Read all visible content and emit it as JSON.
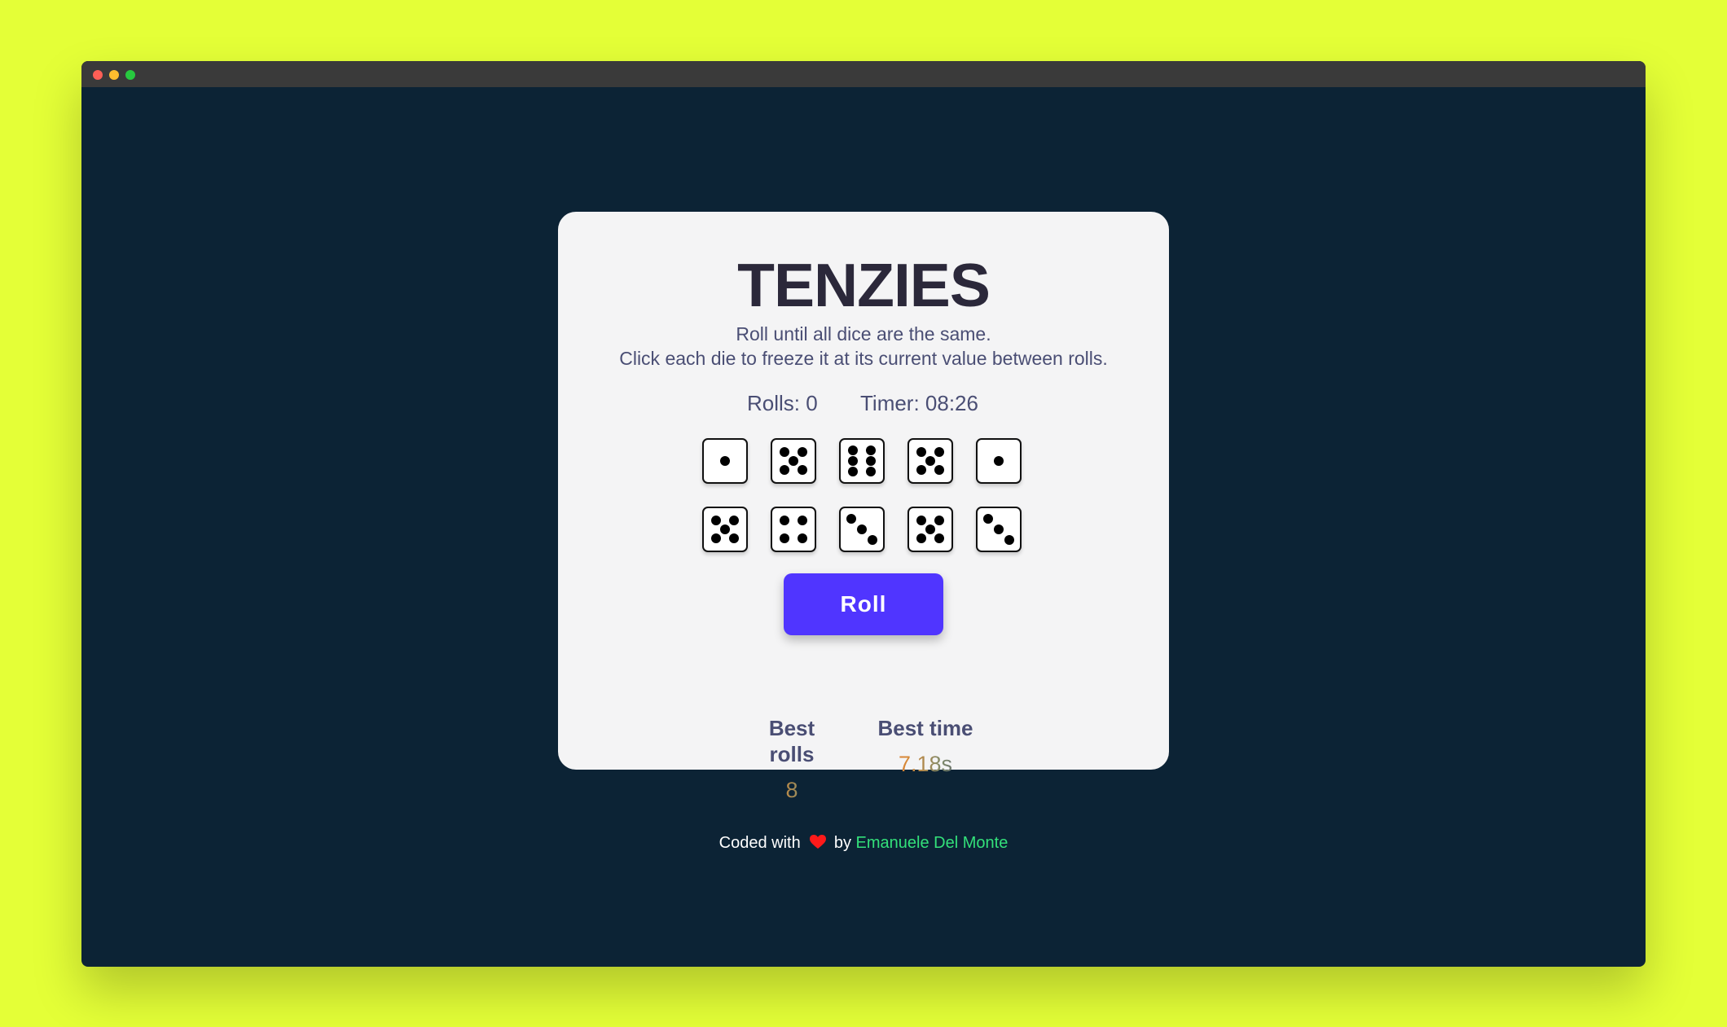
{
  "app": {
    "title": "TENZIES",
    "instructions_line1": "Roll until all dice are the same.",
    "instructions_line2": "Click each die to freeze it at its current value between rolls."
  },
  "stats": {
    "rolls_text": "Rolls: 0",
    "timer_text": "Timer: 08:26"
  },
  "dice": [
    1,
    5,
    6,
    5,
    1,
    5,
    4,
    3,
    5,
    3
  ],
  "roll_button_label": "Roll",
  "best": {
    "rolls_label": "Best rolls",
    "rolls_value": "8",
    "time_label": "Best time",
    "time_value": "7.18s"
  },
  "footer": {
    "prefix": "Coded with",
    "by": "by",
    "author": "Emanuele Del Monte",
    "heart_icon": "heart-icon"
  },
  "colors": {
    "page_background": "#e4ff37",
    "window_background": "#0c2335",
    "card_background": "#f4f4f5",
    "accent": "#5035ff",
    "author_link": "#33e07a",
    "heart": "#ff1a1a"
  }
}
